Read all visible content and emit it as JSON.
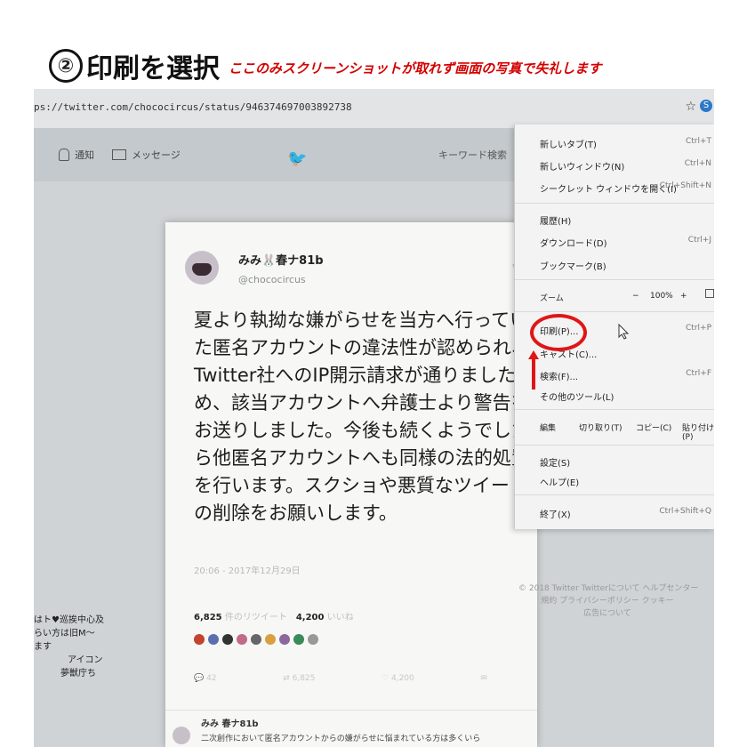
{
  "caption": {
    "step_number": "②",
    "title": "印刷を選択",
    "note": "ここのみスクリーンショットが取れず画面の写真で失礼します"
  },
  "browser": {
    "url": "ps://twitter.com/chococircus/status/946374697003892738"
  },
  "twitter_nav": {
    "notifications": "通知",
    "messages": "メッセージ",
    "search_placeholder": "キーワード検索"
  },
  "tweet": {
    "display_name": "みみ🐰春ナ81b",
    "handle": "@chococircus",
    "text_lines": [
      "夏より執拗な嫌がらせを当方へ行ってい",
      "た匿名アカウントの違法性が認められ、",
      "Twitter社へのIP開示請求が通りましたた",
      "め、該当アカウントへ弁護士より警告を",
      "お送りしました。今後も続くようでした",
      "ら他匿名アカウントへも同様の法的処置",
      "を行います。スクショや悪質なツイート",
      "の削除をお願いします。"
    ],
    "timestamp": "20:06 - 2017年12月29日",
    "retweets_count": "6,825",
    "retweets_label": "件のリツイート",
    "likes_count": "4,200",
    "likes_label": "いいね",
    "actions": {
      "reply": "42",
      "retweet": "6,825",
      "like": "4,200"
    },
    "reply_name": "みみ 春ナ81b",
    "reply_text": "二次創作において匿名アカウントからの嫌がらせに悩まれている方は多くいら"
  },
  "left_side": [
    "はト♥巡挨中心及",
    "らい方は旧M〜",
    "ます",
    "アイコン",
    "夢獣庁ち"
  ],
  "footer": [
    "© 2018 Twitter  Twitterについて  ヘルプセンター",
    "規約  プライバシーポリシー  クッキー",
    "広告について"
  ],
  "menu": {
    "new_tab": "新しいタブ(T)",
    "new_tab_sc": "Ctrl+T",
    "new_window": "新しいウィンドウ(N)",
    "new_window_sc": "Ctrl+N",
    "incognito": "シークレット ウィンドウを開く(I)",
    "incognito_sc": "Ctrl+Shift+N",
    "history": "履歴(H)",
    "downloads": "ダウンロード(D)",
    "downloads_sc": "Ctrl+J",
    "bookmarks": "ブックマーク(B)",
    "zoom": "ズーム",
    "zoom_minus": "−",
    "zoom_value": "100%",
    "zoom_plus": "+",
    "print": "印刷(P)...",
    "print_sc": "Ctrl+P",
    "cast": "キャスト(C)...",
    "find": "検索(F)...",
    "find_sc": "Ctrl+F",
    "more_tools": "その他のツール(L)",
    "edit": "編集",
    "cut": "切り取り(T)",
    "copy": "コピー(C)",
    "paste": "貼り付け(P)",
    "settings": "設定(S)",
    "help": "ヘルプ(E)",
    "exit": "終了(X)",
    "exit_sc": "Ctrl+Shift+Q"
  },
  "colors": {
    "highlight": "#e01616",
    "twitter_blue": "#1c8fe0"
  }
}
